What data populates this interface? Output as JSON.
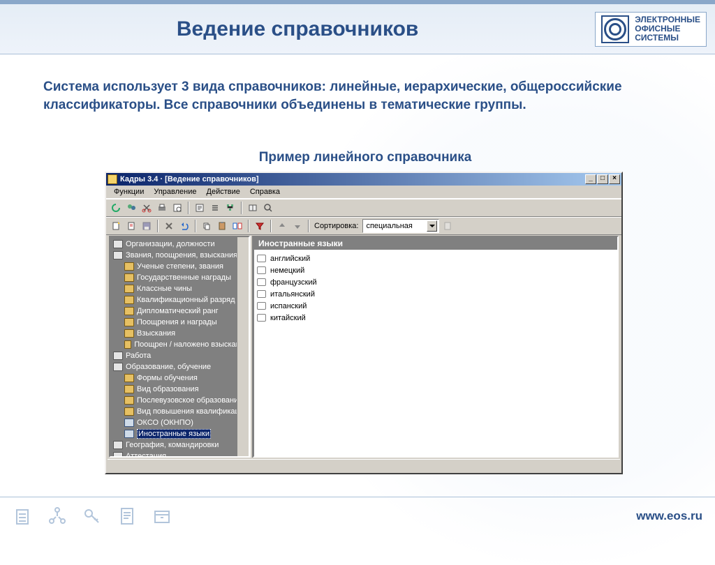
{
  "slide": {
    "title": "Ведение справочников",
    "brand_lines": [
      "ЭЛЕКТРОННЫЕ",
      "ОФИСНЫЕ",
      "СИСТЕМЫ"
    ],
    "paragraph": "Система использует 3 вида справочников: линейные, иерархические, общероссийские классификаторы. Все справочники объединены в тематические группы.",
    "subtitle": "Пример линейного справочника",
    "footer_url": "www.eos.ru"
  },
  "app": {
    "title": "Кадры 3.4 · [Ведение справочников]",
    "menu": [
      "Функции",
      "Управление",
      "Действие",
      "Справка"
    ],
    "sort_label": "Сортировка:",
    "sort_value": "специальная",
    "tree": [
      {
        "label": "Организации, должности",
        "level": 0,
        "kind": "root"
      },
      {
        "label": "Звания, поощрения, взыскания",
        "level": 0,
        "kind": "root"
      },
      {
        "label": "Ученые степени, звания",
        "level": 1,
        "kind": "folder"
      },
      {
        "label": "Государственные награды",
        "level": 1,
        "kind": "folder"
      },
      {
        "label": "Классные чины",
        "level": 1,
        "kind": "folder"
      },
      {
        "label": "Квалификационный разряд",
        "level": 1,
        "kind": "folder"
      },
      {
        "label": "Дипломатический ранг",
        "level": 1,
        "kind": "folder"
      },
      {
        "label": "Поощрения и награды",
        "level": 1,
        "kind": "folder"
      },
      {
        "label": "Взыскания",
        "level": 1,
        "kind": "folder"
      },
      {
        "label": "Поощрен / наложено взыскание",
        "level": 1,
        "kind": "folder"
      },
      {
        "label": "Работа",
        "level": 0,
        "kind": "root"
      },
      {
        "label": "Образование, обучение",
        "level": 0,
        "kind": "root"
      },
      {
        "label": "Формы обучения",
        "level": 1,
        "kind": "folder"
      },
      {
        "label": "Вид образования",
        "level": 1,
        "kind": "folder"
      },
      {
        "label": "Послевузовское образование",
        "level": 1,
        "kind": "folder"
      },
      {
        "label": "Вид повышения квалификации",
        "level": 1,
        "kind": "folder"
      },
      {
        "label": "ОКСО (ОКНПО)",
        "level": 1,
        "kind": "doc"
      },
      {
        "label": "Иностранные языки",
        "level": 1,
        "kind": "doc",
        "selected": true
      },
      {
        "label": "География, командировки",
        "level": 0,
        "kind": "root"
      },
      {
        "label": "Аттестация",
        "level": 0,
        "kind": "root"
      }
    ],
    "list_header": "Иностранные языки",
    "list": [
      "английский",
      "немецкий",
      "французский",
      "итальянский",
      "испанский",
      "китайский"
    ]
  }
}
